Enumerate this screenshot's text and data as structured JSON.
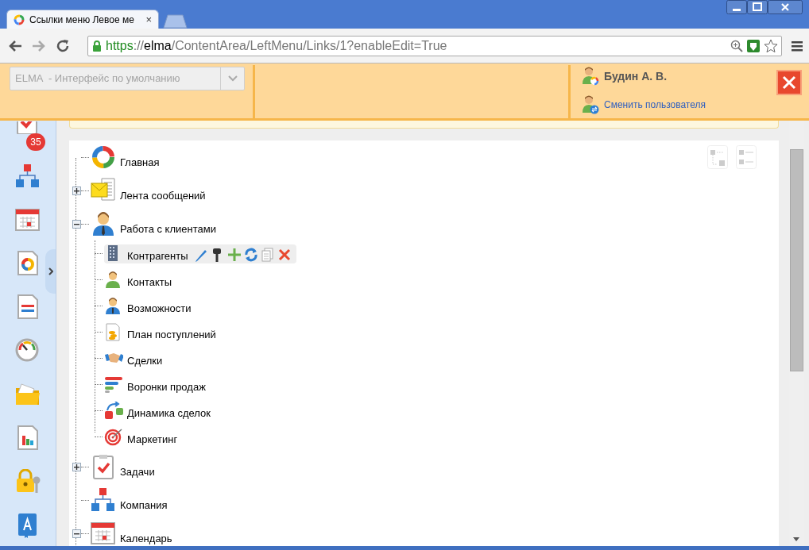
{
  "browser": {
    "tab_title": "Ссылки меню Левое ме",
    "tab_close": "×",
    "url": {
      "scheme": "https",
      "separator": "://",
      "host": "elma",
      "path": "/ContentArea/LeftMenu/Links/1?enableEdit=True"
    }
  },
  "header": {
    "interface_select": {
      "value": "ELMA  - Интерфейс по умолчанию",
      "disabled": true
    },
    "user_name": "Будин А. В.",
    "switch_user_link": "Сменить пользователя"
  },
  "sidebar": {
    "task_badge": "35"
  },
  "tree": [
    {
      "label": "Главная",
      "selected": false
    },
    {
      "label": "Лента сообщений",
      "expanded": false,
      "selected": false
    },
    {
      "label": "Работа с клиентами",
      "expanded": true,
      "selected": false,
      "children": [
        {
          "label": "Контрагенты",
          "selected": true
        },
        {
          "label": "Контакты",
          "selected": false
        },
        {
          "label": "Возможности",
          "selected": false
        },
        {
          "label": "План поступлений",
          "selected": false
        },
        {
          "label": "Сделки",
          "selected": false
        },
        {
          "label": "Воронки продаж",
          "selected": false
        },
        {
          "label": "Динамика сделок",
          "selected": false
        },
        {
          "label": "Маркетинг",
          "selected": false
        }
      ]
    },
    {
      "label": "Задачи",
      "expanded": false,
      "selected": false
    },
    {
      "label": "Компания",
      "selected": false
    },
    {
      "label": "Календарь",
      "expanded": true,
      "selected": false
    }
  ]
}
